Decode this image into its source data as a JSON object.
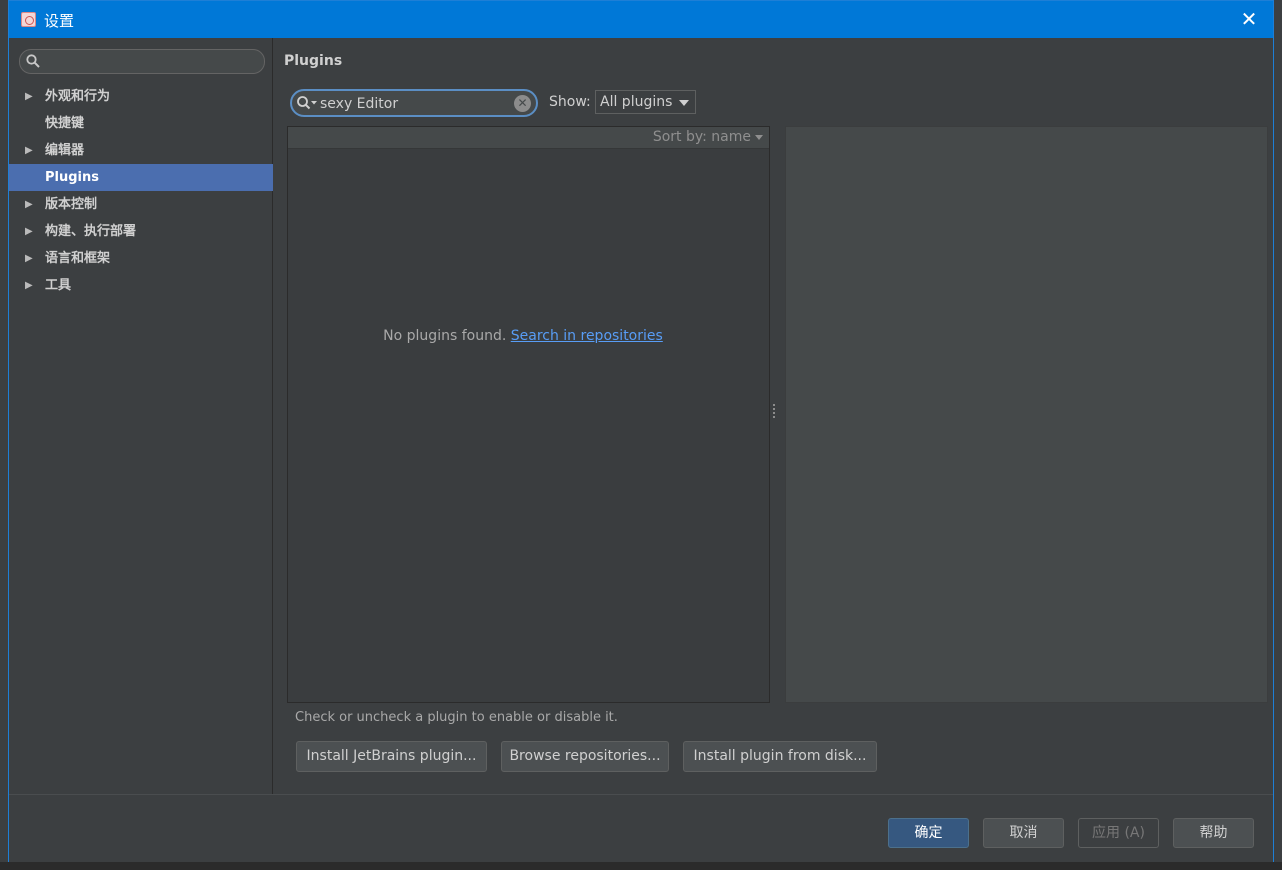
{
  "window": {
    "title": "设置"
  },
  "sidebar": {
    "search_placeholder": "",
    "items": [
      {
        "label": "外观和行为",
        "expandable": true
      },
      {
        "label": "快捷键",
        "expandable": false
      },
      {
        "label": "编辑器",
        "expandable": true
      },
      {
        "label": "Plugins",
        "expandable": false,
        "selected": true
      },
      {
        "label": "版本控制",
        "expandable": true
      },
      {
        "label": "构建、执行部署",
        "expandable": true
      },
      {
        "label": "语言和框架",
        "expandable": true
      },
      {
        "label": "工具",
        "expandable": true
      }
    ]
  },
  "main": {
    "title": "Plugins",
    "search": {
      "value": "sexy Editor"
    },
    "show": {
      "label": "Show:",
      "selected": "All plugins"
    },
    "list": {
      "sort_label": "Sort by: name",
      "empty_text": "No plugins found.",
      "empty_link": "Search in repositories"
    },
    "hint": "Check or uncheck a plugin to enable or disable it.",
    "buttons": {
      "install_jetbrains": "Install JetBrains plugin...",
      "browse": "Browse repositories...",
      "install_disk": "Install plugin from disk..."
    }
  },
  "footer": {
    "ok": "确定",
    "cancel": "取消",
    "apply": "应用 (A)",
    "help": "帮助"
  },
  "colors": {
    "titlebar": "#0078d7",
    "selection": "#4b6eaf",
    "link": "#589df6",
    "ok_button": "#365880"
  }
}
